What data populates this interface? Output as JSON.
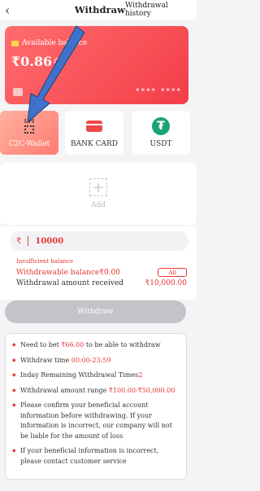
{
  "header": {
    "back_icon": "chevron-left-icon",
    "title": "Withdraw",
    "record_link": "Withdrawal history"
  },
  "balance_card": {
    "label": "Available balance",
    "amount": "₹0.86",
    "masked_number": "****  ****"
  },
  "methods": [
    {
      "label": "C2C-Wallet",
      "icon": "upi-qr-icon",
      "active": true
    },
    {
      "label": "BANK CARD",
      "icon": "bank-card-icon",
      "active": false
    },
    {
      "label": "USDT",
      "icon": "usdt-icon",
      "active": false
    }
  ],
  "add": {
    "label": "Add"
  },
  "amount": {
    "currency_symbol": "₹",
    "value": "10000",
    "error": "Insufficient balance",
    "withdrawable_label": "Withdrawable balance₹0.00",
    "all_label": "All",
    "received_label": "Withdrawal amount received",
    "received_value": "₹10,000.00"
  },
  "withdraw_button": "Withdraw",
  "notes": {
    "n1_pre": "Need to bet ",
    "n1_amount": "₹66.00",
    "n1_post": " to be able to withdraw",
    "n2_pre": "Withdraw time ",
    "n2_time": "00:00-23:59",
    "n3_pre": "Inday Remaining Withdrawal Times",
    "n3_count": "2",
    "n4_pre": "Withdrawal amount range ",
    "n4_range": "₹100.00-₹50,000.00",
    "n5": "Please confirm your beneficial account information before withdrawing. If your information is incorrect, our company will not be liable for the amount of loss",
    "n6": "If your beneficial information is incorrect, please contact customer service"
  },
  "colors": {
    "accent": "#e53935",
    "card_gradient_start": "#ff6d6d",
    "usdt": "#1ba27a",
    "arrow_annotation": "#3f72c9"
  }
}
